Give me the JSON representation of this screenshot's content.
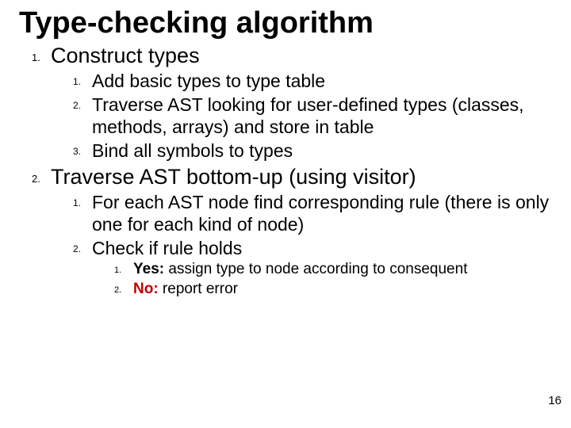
{
  "title": "Type-checking algorithm",
  "page_number": "16",
  "list": {
    "item1": {
      "num": "1.",
      "text": "Construct types",
      "sub": {
        "s1": {
          "num": "1.",
          "text": "Add basic types to type table"
        },
        "s2": {
          "num": "2.",
          "text": "Traverse AST looking for user-defined types (classes, methods, arrays) and store in table"
        },
        "s3": {
          "num": "3.",
          "text": "Bind all symbols to types"
        }
      }
    },
    "item2": {
      "num": "2.",
      "text": "Traverse AST bottom-up (using visitor)",
      "sub": {
        "s1": {
          "num": "1.",
          "text": "For each AST node find corresponding rule (there is only one for each kind of node)"
        },
        "s2": {
          "num": "2.",
          "text": "Check if rule holds",
          "sub": {
            "t1": {
              "num": "1.",
              "yes": "Yes:",
              "text": " assign type to node according to consequent"
            },
            "t2": {
              "num": "2.",
              "no": "No:",
              "text": " report error"
            }
          }
        }
      }
    }
  }
}
